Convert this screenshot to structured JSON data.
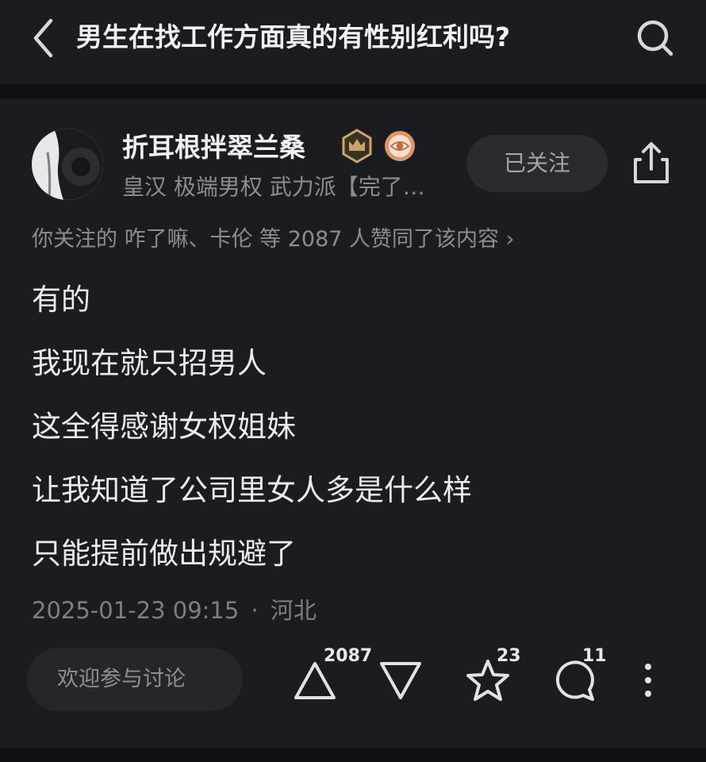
{
  "header": {
    "title": "男生在找工作方面真的有性别红利吗?"
  },
  "author": {
    "name": "折耳根拌翠兰桑",
    "bio": "皇汉 极端男权 武力派【完了…",
    "follow_label": "已关注"
  },
  "upvote_info": "你关注的 咋了嘛、卡伦 等 2087 人赞同了该内容 ›",
  "content": {
    "lines": [
      "有的",
      "我现在就只招男人",
      "这全得感谢女权姐妹",
      "让我知道了公司里女人多是什么样",
      "只能提前做出规避了"
    ]
  },
  "meta": {
    "timestamp": "2025-01-23 09:15",
    "separator": "·",
    "location": "河北"
  },
  "actions": {
    "comment_placeholder": "欢迎参与讨论",
    "upvote_count": "2087",
    "favorite_count": "23",
    "comment_count": "11"
  },
  "colors": {
    "background": "#0f1013",
    "card": "#1b1c20",
    "badge_gold": "#c9a46a",
    "badge_orange": "#e0956a"
  },
  "icons": [
    "back-icon",
    "search-icon",
    "crown-badge-icon",
    "eye-badge-icon",
    "share-icon",
    "upvote-icon",
    "downvote-icon",
    "star-icon",
    "comment-icon",
    "more-icon"
  ]
}
